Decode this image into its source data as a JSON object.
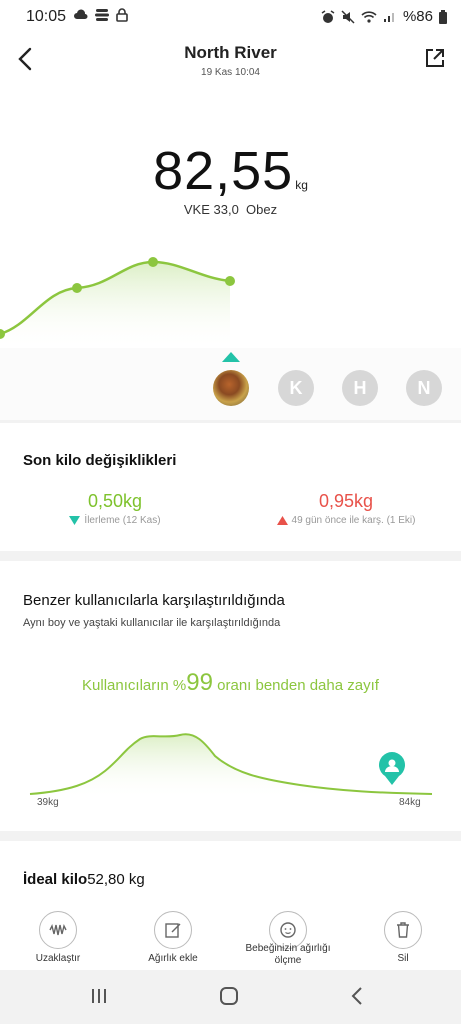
{
  "status_bar": {
    "time": "10:05",
    "battery": "%86"
  },
  "header": {
    "title": "North River",
    "subtitle": "19 Kas 10:04"
  },
  "weight": {
    "value": "82,55",
    "unit": "kg",
    "bmi": "VKE 33,0",
    "bmi_status": "Obez"
  },
  "profiles": [
    {
      "letter": "K"
    },
    {
      "letter": "H"
    },
    {
      "letter": "N"
    }
  ],
  "recent_changes": {
    "title": "Son kilo değişiklikleri",
    "left_value": "0,50kg",
    "left_note": "İlerleme (12 Kas)",
    "right_value": "0,95kg",
    "right_note": "49 gün önce ile karş. (1 Eki)",
    "colors": {
      "positive": "#7ec22d",
      "negative": "#e8524a",
      "teal": "#23c2a8"
    }
  },
  "comparison": {
    "title": "Benzer kullanıcılarla karşılaştırıldığında",
    "subtitle": "Aynı boy ve yaştaki kullanıcılar ile karşılaştırıldığında",
    "text_before": "Kullanıcıların %",
    "percent": "99",
    "text_after": " oranı benden daha zayıf",
    "min_label": "39kg",
    "max_label": "84kg"
  },
  "ideal": {
    "label": "İdeal kilo",
    "value": "52,80 kg"
  },
  "actions": [
    {
      "icon": "waveform-icon",
      "label": "Uzaklaştır"
    },
    {
      "icon": "edit-icon",
      "label": "Ağırlık ekle"
    },
    {
      "icon": "baby-face-icon",
      "label": "Bebeğinizin ağırlığı ölçme"
    },
    {
      "icon": "trash-icon",
      "label": "Sil"
    }
  ]
}
